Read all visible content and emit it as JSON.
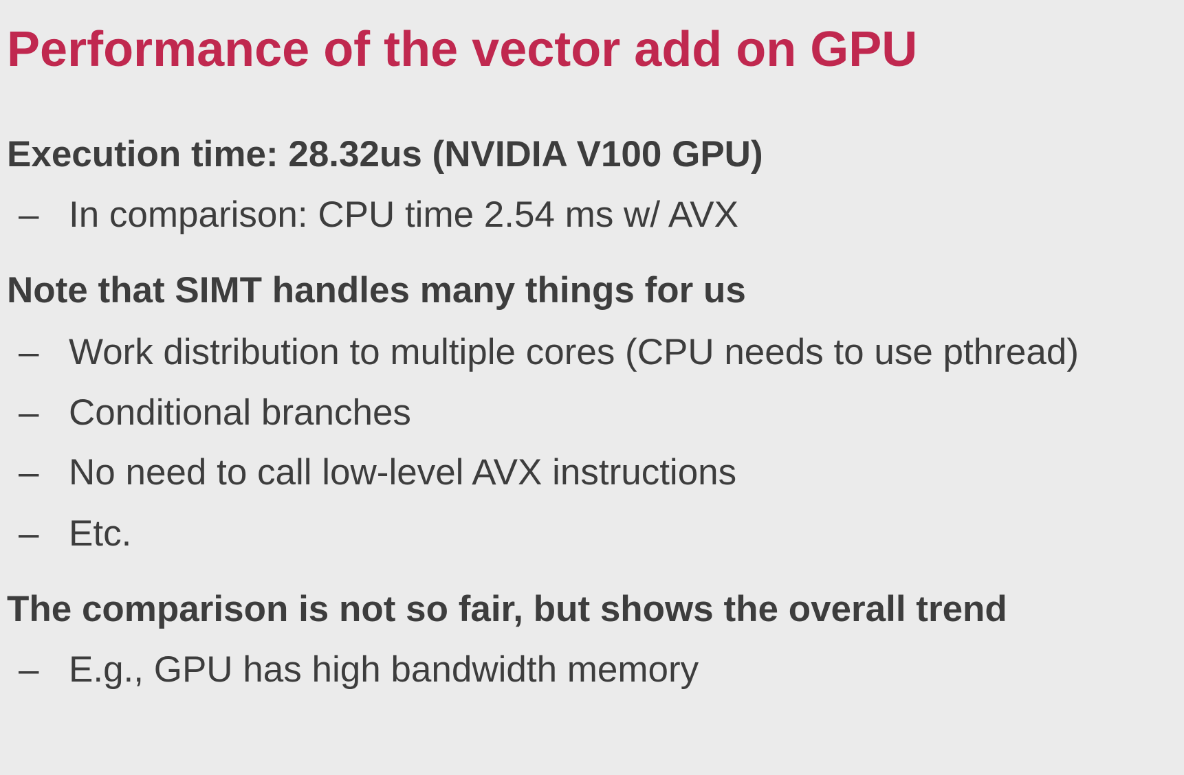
{
  "title": "Performance of the vector add on GPU",
  "sections": [
    {
      "heading": "Execution time: 28.32us (NVIDIA V100 GPU)",
      "bullets": [
        "In comparison: CPU time 2.54 ms w/ AVX"
      ]
    },
    {
      "heading": "Note that SIMT handles many things for us",
      "bullets": [
        "Work distribution to multiple cores (CPU needs to use pthread)",
        "Conditional branches",
        "No need to call low-level AVX instructions",
        "Etc."
      ]
    },
    {
      "heading": "The comparison is not so fair, but shows the overall trend",
      "bullets": [
        "E.g., GPU has high bandwidth memory"
      ]
    }
  ],
  "bullet_marker": "–"
}
